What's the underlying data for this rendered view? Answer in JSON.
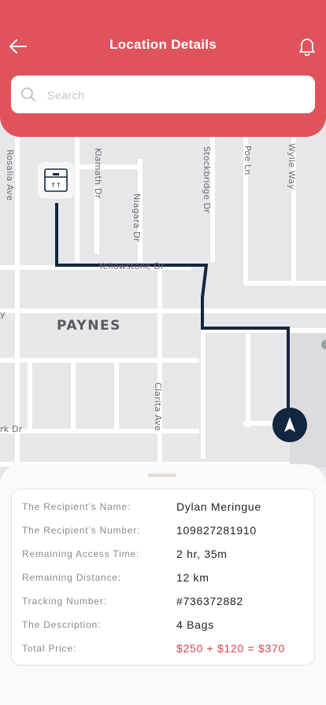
{
  "header": {
    "title": "Location Details",
    "search_placeholder": "Search"
  },
  "map": {
    "streets": [
      "Rosalia Ave",
      "Klamath Dr",
      "Niagara Dr",
      "Stockbridge Dr",
      "Poe Ln",
      "Wylie Way",
      "Yellowstone Dr",
      "Clarita Ave",
      "rk Dr",
      "y"
    ],
    "district": "PAYNES"
  },
  "details": {
    "rows": [
      {
        "label": "The Recipient’s Name:",
        "value": "Dylan Meringue"
      },
      {
        "label": "The Recipient’s Number:",
        "value": "109827281910"
      },
      {
        "label": "Remaining Access Time:",
        "value": "2 hr, 35m"
      },
      {
        "label": "Remaining Distance:",
        "value": "12 km"
      },
      {
        "label": "Tracking Number:",
        "value": "#736372882"
      },
      {
        "label": "The Description:",
        "value": "4 Bags"
      },
      {
        "label": "Total Price:",
        "value": "$250 + $120 = $370"
      }
    ]
  },
  "colors": {
    "header": "#e0535c",
    "route": "#12263f",
    "price": "#d9444f"
  },
  "icons": [
    "back-arrow-icon",
    "bell-icon",
    "search-icon",
    "package-box-icon",
    "navigation-arrow-icon"
  ]
}
